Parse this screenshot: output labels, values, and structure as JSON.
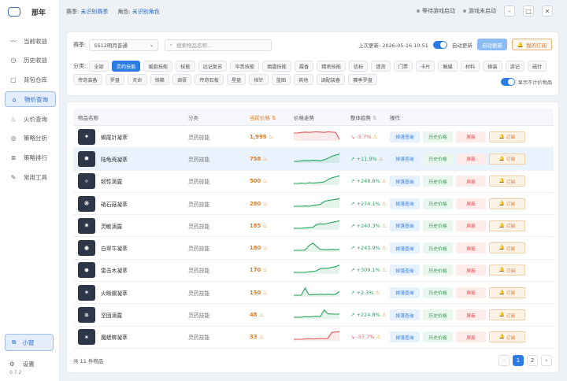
{
  "app": {
    "title": "那年",
    "version": "0.7.2"
  },
  "sidebar": {
    "items": [
      {
        "label": "当前收益",
        "icon": "activity-icon"
      },
      {
        "label": "历史收益",
        "icon": "history-icon"
      },
      {
        "label": "背包仓库",
        "icon": "box-icon"
      },
      {
        "label": "物价查询",
        "icon": "tag-icon"
      },
      {
        "label": "火价查询",
        "icon": "flame-icon"
      },
      {
        "label": "策略分析",
        "icon": "compass-icon"
      },
      {
        "label": "策略排行",
        "icon": "ranking-icon"
      },
      {
        "label": "常用工具",
        "icon": "wrench-icon"
      }
    ],
    "mini": "小窗",
    "settings": "设置"
  },
  "topbar": {
    "season_label": "赛季:",
    "season_value": "未识别赛季",
    "role_label": "角色:",
    "role_value": "未识别角色",
    "status1": "等待游戏启动",
    "status2": "游戏未启动"
  },
  "filters": {
    "season_label": "赛季:",
    "season_select": "SS12明月普通",
    "search_placeholder": "搜索物品名称...",
    "last_update": "上次更新: 2026-05-16 10:51",
    "auto_update": "自动更新",
    "auto_update_btn": "自动更新",
    "subscribe_btn": "我的订阅",
    "category_label": "分类:",
    "categories": [
      "全部",
      "灵药技能",
      "暖脂技能",
      "技能",
      "远记复苏",
      "华贵技能",
      "面霜技能",
      "霞香",
      "精密技能",
      "信标",
      "遗货",
      "门票",
      "卡片",
      "触媒",
      "材料",
      "换装",
      "游记",
      "磁针",
      "传奇装备",
      "罗盘",
      "天命",
      "钱箱",
      "调膏",
      "传奇石板",
      "星盘",
      "探针",
      "蓝图",
      "其他",
      "调配装备",
      "赛季罗盘"
    ],
    "active_category": "灵药技能",
    "show_unpriced": "显示不计价物品"
  },
  "table": {
    "headers": {
      "name": "物品名称",
      "category": "分类",
      "price": "当前价格",
      "trend": "价格走势",
      "overall": "整体趋势",
      "ops": "操作"
    },
    "op_labels": {
      "query": "掉落查询",
      "history": "历史价格",
      "block": "屏蔽",
      "subscribe": "订阅"
    },
    "rows": [
      {
        "name": "蝎尾针凝萃",
        "category": "灵药技能",
        "price": "1,999",
        "overall": "-5.7%",
        "dir": "down",
        "spark": [
          3,
          3,
          3.2,
          3.3,
          3.2,
          3.3,
          3.4,
          3.3,
          3.2,
          3.4,
          3.3,
          3.2,
          1
        ]
      },
      {
        "name": "陆龟壳凝萃",
        "category": "灵药技能",
        "price": "758",
        "overall": "+11.9%",
        "dir": "up",
        "spark": [
          1,
          1,
          1.2,
          1.3,
          1.2,
          1.4,
          1.3,
          1.2,
          1.5,
          2,
          2.6,
          3,
          3.3
        ]
      },
      {
        "name": "韧性滴露",
        "category": "灵药技能",
        "price": "500",
        "overall": "+248.8%",
        "dir": "up",
        "spark": [
          1,
          1,
          1.1,
          1,
          1.2,
          1.1,
          1.2,
          1.3,
          1.5,
          2.2,
          2.8,
          3.1,
          3.4
        ]
      },
      {
        "name": "硝石菇凝萃",
        "category": "灵药技能",
        "price": "280",
        "overall": "+274.1%",
        "dir": "up",
        "spark": [
          1,
          1,
          1,
          1.1,
          1,
          1.2,
          1.4,
          1.6,
          2.5,
          2.8,
          3,
          3.2,
          3.4
        ]
      },
      {
        "name": "灵敏滴露",
        "category": "灵药技能",
        "price": "185",
        "overall": "+240.3%",
        "dir": "up",
        "spark": [
          1,
          1,
          1,
          1.1,
          1.2,
          1.3,
          2.2,
          2.4,
          2.3,
          2.6,
          2.9,
          3.1,
          3.4
        ]
      },
      {
        "name": "白翠牛凝萃",
        "category": "灵药技能",
        "price": "180",
        "overall": "+243.9%",
        "dir": "up",
        "spark": [
          1,
          1,
          1,
          1.1,
          2.5,
          3.3,
          2.2,
          1.3,
          1.2,
          1.2,
          1.3,
          1.2,
          1.3
        ]
      },
      {
        "name": "雷击木凝萃",
        "category": "灵药技能",
        "price": "170",
        "overall": "+309.1%",
        "dir": "up",
        "spark": [
          1,
          1,
          1,
          1,
          1.2,
          1.3,
          1.5,
          2.2,
          2.3,
          2.3,
          2.6,
          2.8,
          3.3
        ]
      },
      {
        "name": "火晰蜴凝萃",
        "category": "灵药技能",
        "price": "150",
        "overall": "+2.3%",
        "dir": "up",
        "spark": [
          1,
          1,
          1,
          3.3,
          1.1,
          1.2,
          1.2,
          1.3,
          1.2,
          1.3,
          1.2,
          1.3,
          2.2
        ]
      },
      {
        "name": "坚固滴露",
        "category": "灵药技能",
        "price": "48",
        "overall": "+224.8%",
        "dir": "up",
        "spark": [
          1,
          1,
          1,
          1.2,
          1.1,
          1.2,
          1.3,
          1.2,
          3.3,
          2.1,
          2,
          2,
          2
        ]
      },
      {
        "name": "魔蟋蟀凝萃",
        "category": "灵药技能",
        "price": "33",
        "overall": "-57.7%",
        "dir": "down",
        "spark": [
          1,
          1,
          1,
          1.1,
          1.2,
          1.1,
          1.2,
          1.3,
          1.2,
          1.3,
          3.2,
          3.3,
          3.4
        ]
      }
    ]
  },
  "pager": {
    "total": "共 11 件物品",
    "pages": [
      "1",
      "2"
    ],
    "prev": "‹",
    "next": "›"
  },
  "colors": {
    "accent": "#2c7be5",
    "up": "#27a35a",
    "down": "#e05656"
  }
}
